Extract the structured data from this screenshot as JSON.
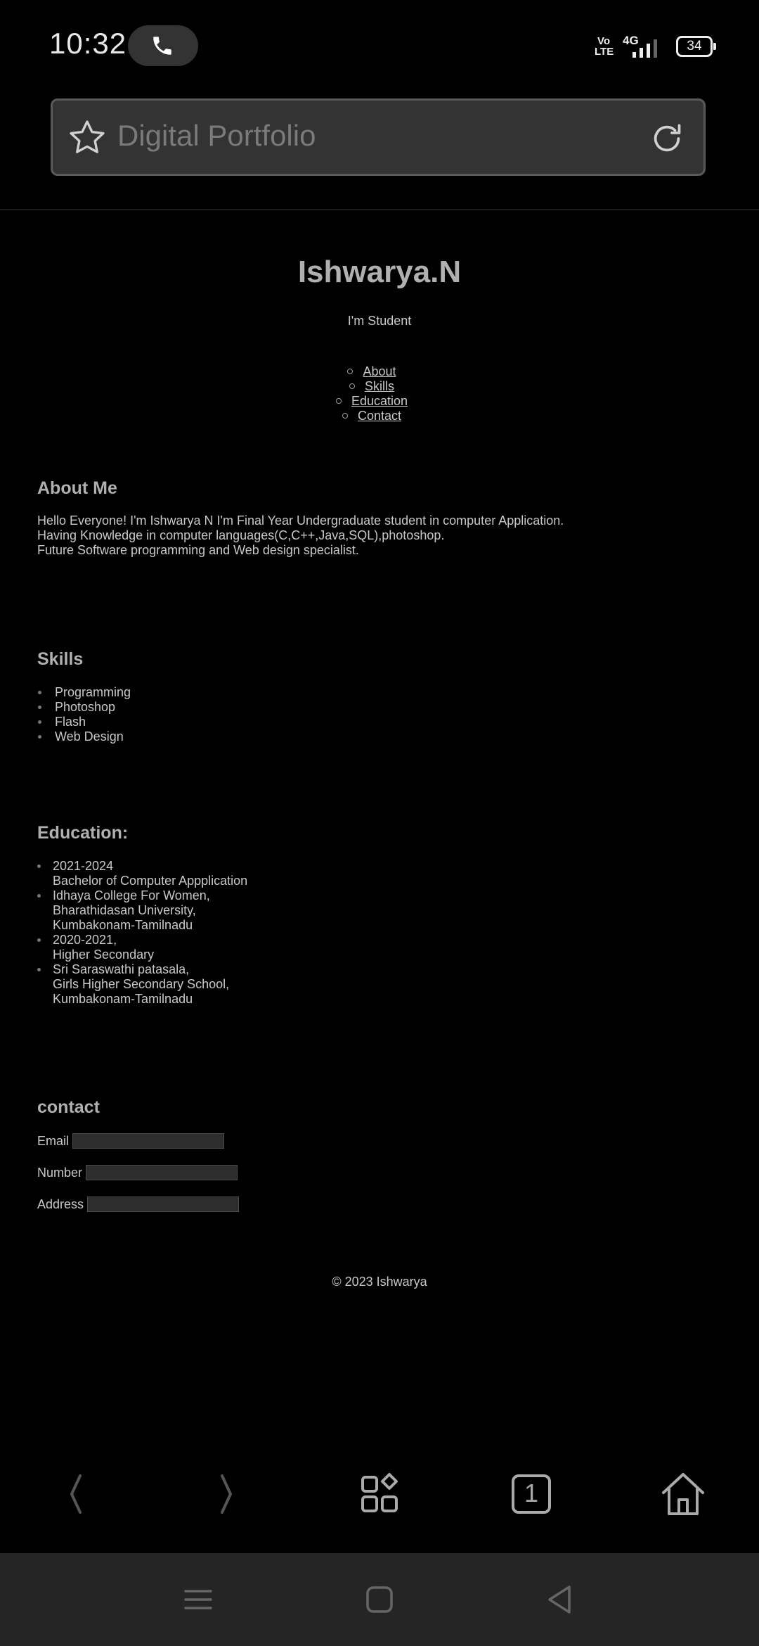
{
  "status": {
    "time": "10:32",
    "volte": "Vo\nLTE",
    "network": "4G",
    "battery": "34"
  },
  "address_bar": {
    "title": "Digital Portfolio"
  },
  "header": {
    "name": "Ishwarya.N",
    "tagline": "I'm Student"
  },
  "nav": {
    "items": [
      "About",
      "Skills",
      "Education",
      "Contact"
    ]
  },
  "about": {
    "title": "About Me",
    "lines": [
      "Hello Everyone! I'm Ishwarya N I'm Final Year Undergraduate student in computer Application.",
      "Having Knowledge in computer languages(C,C++,Java,SQL),photoshop.",
      "Future Software programming and Web design specialist."
    ]
  },
  "skills": {
    "title": "Skills",
    "items": [
      "Programming",
      "Photoshop",
      "Flash",
      "Web Design"
    ]
  },
  "education": {
    "title": "Education:",
    "items": [
      "2021-2024\nBachelor of Computer Appplication",
      "Idhaya College For Women,\nBharathidasan University,\nKumbakonam-Tamilnadu",
      "2020-2021,\nHigher Secondary",
      "Sri Saraswathi patasala,\nGirls Higher Secondary School,\nKumbakonam-Tamilnadu"
    ]
  },
  "contact": {
    "title": "contact",
    "fields": [
      {
        "label": "Email",
        "value": ""
      },
      {
        "label": "Number",
        "value": ""
      },
      {
        "label": "Address",
        "value": ""
      }
    ]
  },
  "footer": {
    "text": "© 2023 Ishwarya"
  },
  "browser_nav": {
    "tab_count": "1"
  },
  "icons": [
    "phone-icon",
    "star-icon",
    "reload-icon",
    "back-icon",
    "forward-icon",
    "apps-icon",
    "tabs-icon",
    "home-icon",
    "menu-icon",
    "recents-icon",
    "system-back-icon"
  ]
}
